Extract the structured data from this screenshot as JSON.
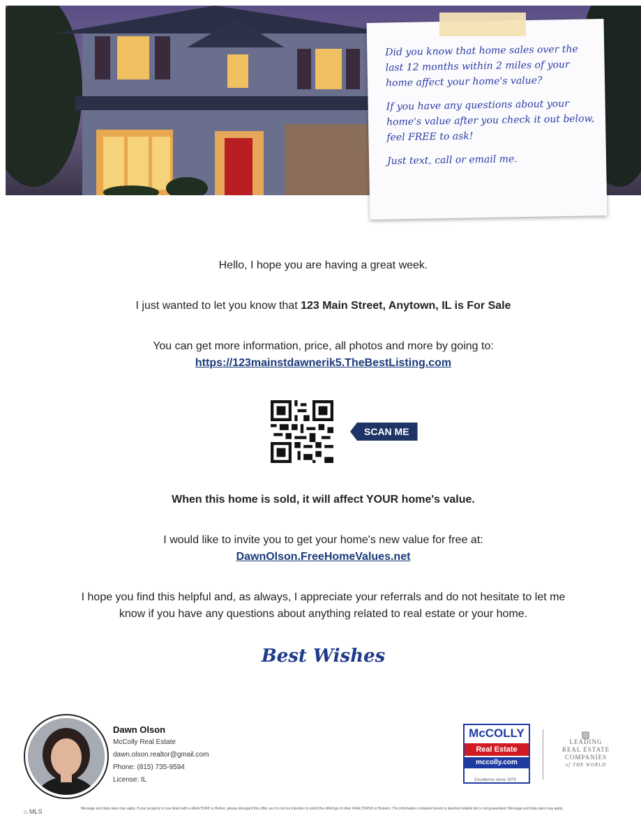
{
  "note": {
    "paragraphs": [
      "Did you know that home sales over the last 12 months within 2 miles of your home affect your home's value?",
      "If you have any questions about your home's value after you check it out below, feel FREE to ask!",
      "Just text, call or email me."
    ]
  },
  "body": {
    "greeting": "Hello, I hope you are having a great week.",
    "intro_prefix": "I just wanted to let you know that ",
    "intro_bold": "123 Main Street, Anytown, IL is For Sale",
    "info_line": "You can get more information, price, all photos and more by going to:",
    "listing_link": "https://123mainstdawnerik5.TheBestListing.com",
    "scan_label": "SCAN ME",
    "affect_line": "When this home is sold, it will affect YOUR home's value.",
    "invite_line": "I would like to invite you to get your home's new value for free at:",
    "value_link": "DawnOlson.FreeHomeValues.net",
    "closing_line1": "I hope you find this helpful and, as always, I appreciate your referrals and do not hesitate to let me",
    "closing_line2": "know if you have any questions about anything related to real estate or your home.",
    "sign_off": "Best Wishes"
  },
  "agent": {
    "name": "Dawn Olson",
    "company": "McColly Real Estate",
    "email": "dawn.olson.realtor@gmail.com",
    "phone": "Phone: (815) 735-9594",
    "license": "License: IL"
  },
  "logos": {
    "mccolly_top": "McCOLLY",
    "mccolly_mid": "Real Estate",
    "mccolly_url": "mccolly.com",
    "mccolly_tagline": "Excellence since 1979",
    "lrec_line1": "LEADING",
    "lrec_line2": "REAL ESTATE",
    "lrec_line3": "COMPANIES",
    "lrec_line4": "of THE WORLD"
  },
  "footer": {
    "eho": "MLS",
    "disclaimer": "Message and data rates may apply. If your property is now listed with a REALTOR® or Broker, please disregard this offer, as it is not our intention to solicit the offerings of other REALTORS® or Brokers. The information contained herein is deemed reliable but is not guaranteed. Message and data rates may apply."
  },
  "colors": {
    "accent": "#1f3466",
    "link": "#1a3a7a",
    "note_ink": "#2a3aa6"
  }
}
